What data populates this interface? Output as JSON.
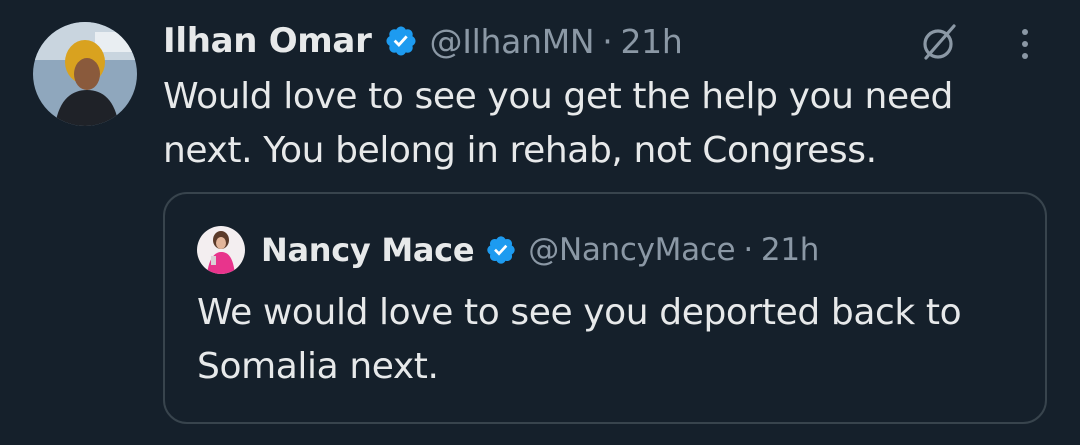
{
  "tweet": {
    "author_name": "Ilhan Omar",
    "author_handle": "@IlhanMN",
    "separator": "·",
    "time": "21h",
    "text": "Would love to see you get the help you need next. You belong in rehab, not Congress.",
    "icons": [
      "avatar",
      "verified-badge-icon",
      "grok-icon",
      "more-options-icon"
    ]
  },
  "quoted_tweet": {
    "author_name": "Nancy Mace",
    "author_handle": "@NancyMace",
    "separator": "·",
    "time": "21h",
    "text": "We would love to see you deported back to Somalia next.",
    "icons": [
      "avatar",
      "verified-badge-icon"
    ]
  },
  "colors": {
    "background": "#15202b",
    "primary_text": "#e7e9ea",
    "secondary_text": "#8b98a5",
    "verified_blue": "#1d9bf0",
    "border": "#38444d"
  }
}
